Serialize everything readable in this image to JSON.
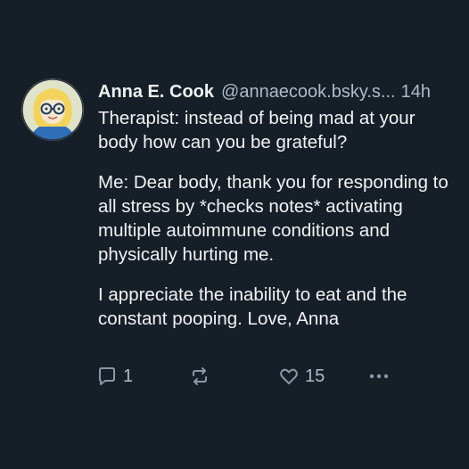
{
  "post": {
    "author": {
      "display_name": "Anna E. Cook",
      "handle": "@annaecook.bsky.s...",
      "timestamp": "14h"
    },
    "paragraphs": [
      "Therapist: instead of being mad at your body how can you be grateful?",
      "Me: Dear body, thank you for responding to all stress by *checks notes* activating multiple autoimmune conditions and physically hurting me.",
      "I appreciate the inability to eat and the constant pooping. Love, Anna"
    ],
    "actions": {
      "reply_count": "1",
      "repost_count": "",
      "like_count": "15"
    }
  },
  "colors": {
    "background": "#161e27",
    "text": "#f1f3f5",
    "muted": "#aebbc9",
    "icon": "#8a97a6"
  },
  "icons": [
    "avatar",
    "reply-icon",
    "repost-icon",
    "like-icon",
    "more-icon"
  ]
}
